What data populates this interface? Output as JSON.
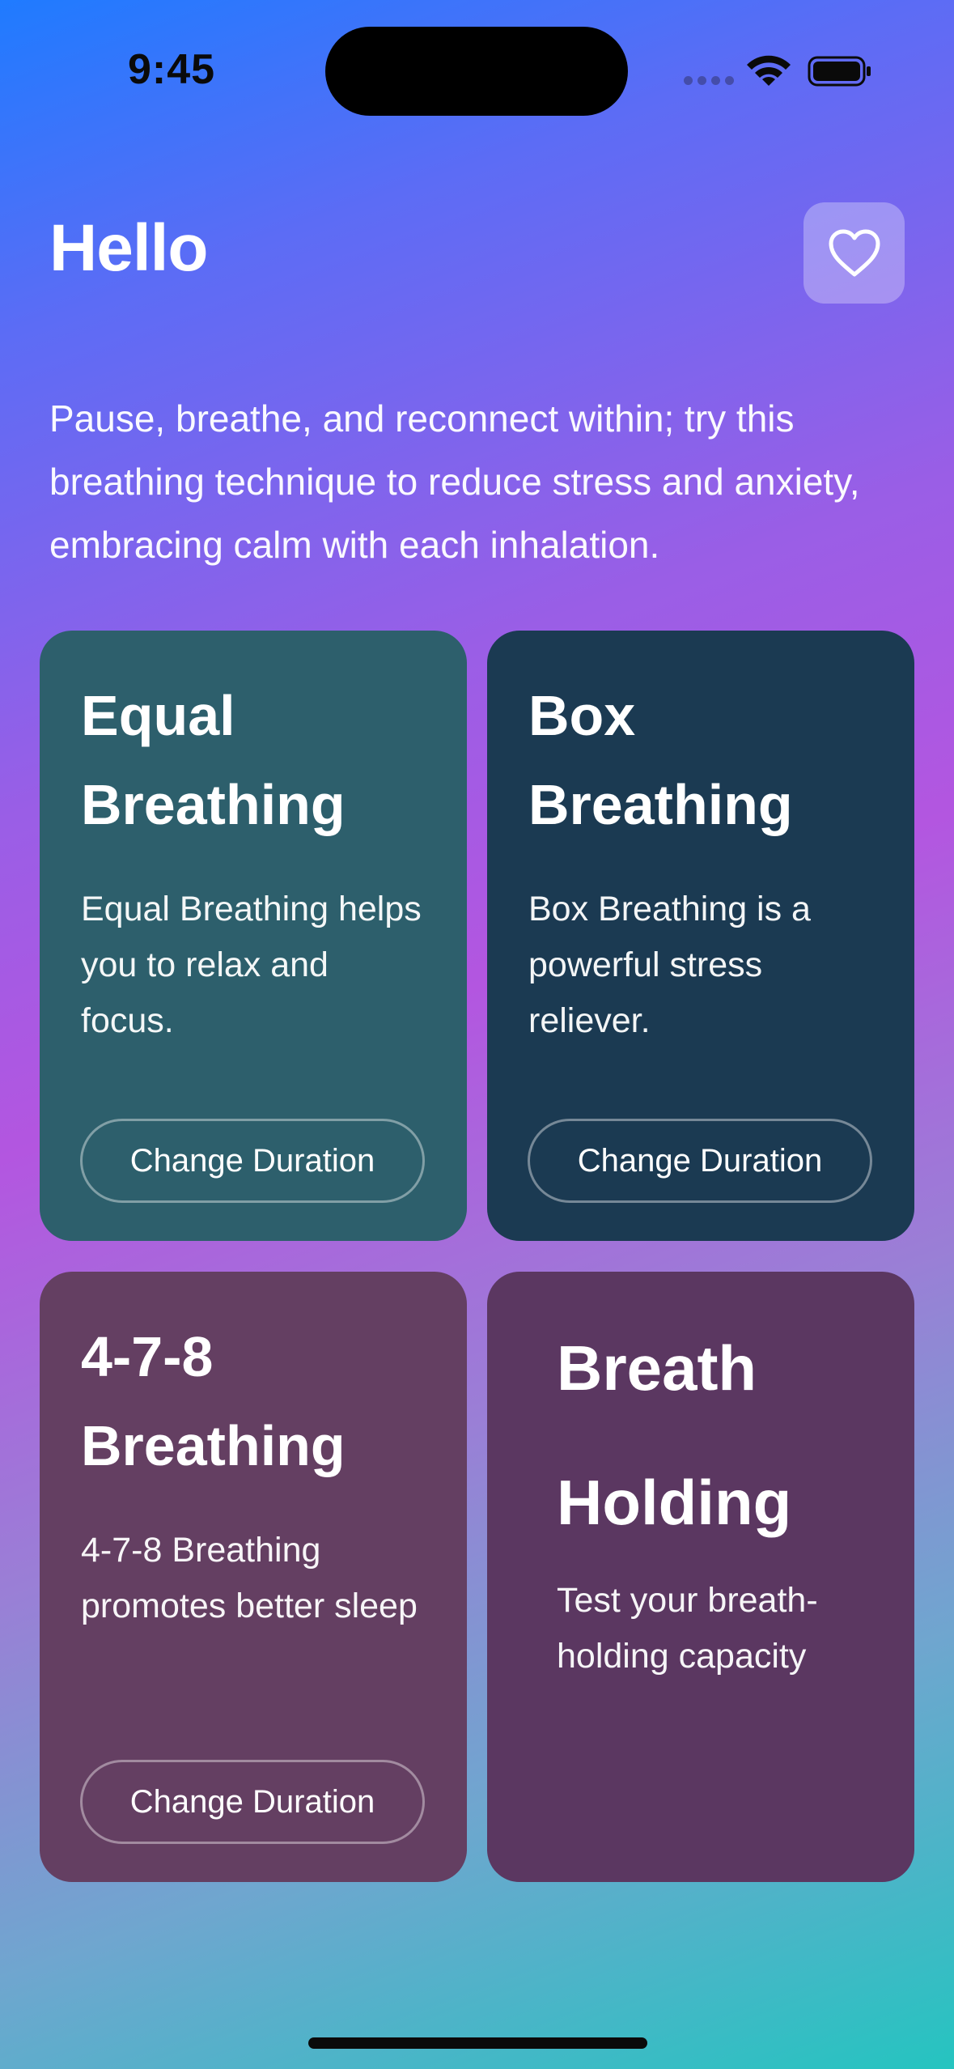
{
  "status_bar": {
    "time": "9:45"
  },
  "header": {
    "greeting": "Hello",
    "favorite_icon": "heart-outline-icon"
  },
  "intro_text": "Pause, breathe, and reconnect within; try this breathing technique to reduce stress and anxiety, embracing calm with each inhalation.",
  "cards": [
    {
      "title": "Equal Breathing",
      "description": "Equal Breathing helps you to relax and focus.",
      "button_label": "Change Duration",
      "color": "#2d5f6c"
    },
    {
      "title": "Box Breathing",
      "description": "Box Breathing is a powerful stress reliever.",
      "button_label": "Change Duration",
      "color": "#1b3a52"
    },
    {
      "title": "4-7-8 Breathing",
      "description": "4-7-8 Breathing promotes better sleep",
      "button_label": "Change Duration",
      "color": "#643f62"
    },
    {
      "title": "Breath Holding",
      "description": "Test your breath-holding capacity",
      "color": "#5b3761"
    }
  ],
  "colors": {
    "gradient_top": "#1f7bff",
    "gradient_middle": "#b356e0",
    "gradient_bottom": "#25c4c0"
  }
}
